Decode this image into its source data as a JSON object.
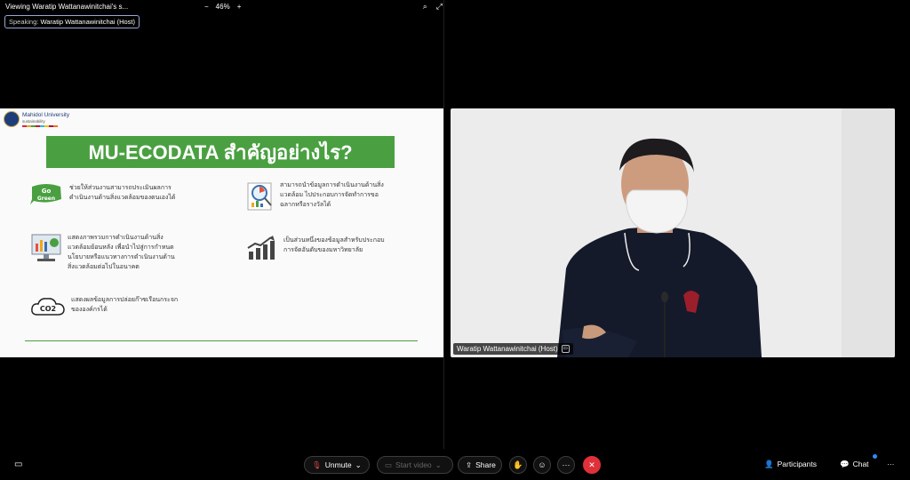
{
  "window": {
    "title": "Viewing Waratip Wattanawinitchai's s...",
    "zoom_out": "−",
    "zoom_level": "46%",
    "zoom_in": "+"
  },
  "speaking": {
    "label": "Speaking:",
    "name": "Waratip Wattanawinitchai (Host)"
  },
  "slide": {
    "logo_name": "Mahidol University",
    "logo_sub": "sustainability",
    "heading": "MU-ECODATA สำคัญอย่างไร?",
    "items": [
      {
        "icon": "go-green-icon",
        "text": "ช่วยให้ส่วนงานสามารถประเมินผลการ\nดำเนินงานด้านสิ่งแวดล้อมของตนเองได้"
      },
      {
        "icon": "data-analysis-icon",
        "text": "สามารถนำข้อมูลการดำเนินงานด้านสิ่ง\nแวดล้อม ไปประกอบการจัดทำการขอ\nฉลากหรือรางวัลได้"
      },
      {
        "icon": "dashboard-icon",
        "text": "แสดงภาพรวมการดำเนินงานด้านสิ่ง\nแวดล้อมย้อนหลัง เพื่อนำไปสู่การกำหนด\nนโยบายหรือแนวทางการดำเนินงานด้าน\nสิ่งแวดล้อมต่อไปในอนาคต"
      },
      {
        "icon": "growth-chart-icon",
        "text": "เป็นส่วนหนึ่งของข้อมูลสำหรับประกอบ\nการจัดอันดับของมหาวิทยาลัย"
      },
      {
        "icon": "co2-cloud-icon",
        "text": "แสดงผลข้อมูลการปล่อยก๊าซเรือนกระจก\nขององค์กรได้"
      }
    ],
    "go_green_text": "Go Green",
    "co2_text": "CO2"
  },
  "video": {
    "participant_name": "Waratip Wattanawinitchai (Host)"
  },
  "controls": {
    "unmute": "Unmute",
    "start_video": "Start video",
    "share": "Share",
    "participants": "Participants",
    "chat": "Chat",
    "more": "···"
  },
  "colors": {
    "green": "#4aa041",
    "end_red": "#e0303a",
    "muted_red": "#e04848"
  }
}
